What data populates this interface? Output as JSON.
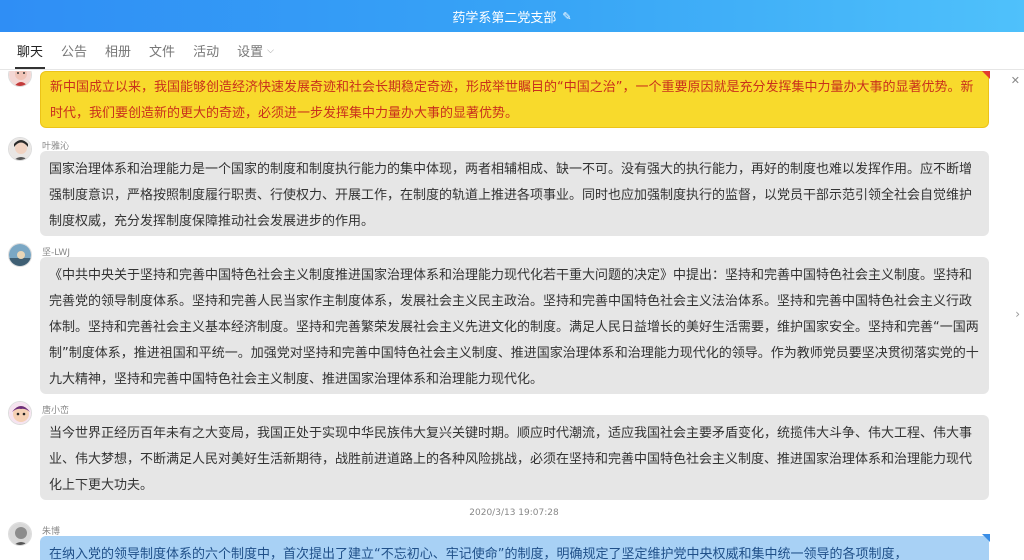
{
  "window": {
    "title": "药学系第二党支部",
    "edit_icon": "pencil-icon"
  },
  "tabs": [
    {
      "label": "聊天",
      "active": true
    },
    {
      "label": "公告",
      "active": false
    },
    {
      "label": "相册",
      "active": false
    },
    {
      "label": "文件",
      "active": false
    },
    {
      "label": "活动",
      "active": false
    },
    {
      "label": "设置",
      "active": false
    }
  ],
  "tab_caret": "⌵",
  "messages": [
    {
      "sender": "",
      "text": "新中国成立以来，我国能够创造经济快速发展奇迹和社会长期稳定奇迹，形成举世瞩目的“中国之治”，一个重要原因就是充分发挥集中力量办大事的显著优势。新时代，我们要创造新的更大的奇迹，必须进一步发挥集中力量办大事的显著优势。",
      "style": "yellow"
    },
    {
      "sender": "叶雅沁",
      "text": "国家治理体系和治理能力是一个国家的制度和制度执行能力的集中体现，两者相辅相成、缺一不可。没有强大的执行能力，再好的制度也难以发挥作用。应不断增强制度意识，严格按照制度履行职责、行使权力、开展工作，在制度的轨道上推进各项事业。同时也应加强制度执行的监督，以党员干部示范引领全社会自觉维护制度权威，充分发挥制度保障推动社会发展进步的作用。",
      "style": "grey"
    },
    {
      "sender": "坚-LWJ",
      "text": "《中共中央关于坚持和完善中国特色社会主义制度推进国家治理体系和治理能力现代化若干重大问题的决定》中提出：坚持和完善中国特色社会主义制度。坚持和完善党的领导制度体系。坚持和完善人民当家作主制度体系，发展社会主义民主政治。坚持和完善中国特色社会主义法治体系。坚持和完善中国特色社会主义行政体制。坚持和完善社会主义基本经济制度。坚持和完善繁荣发展社会主义先进文化的制度。满足人民日益增长的美好生活需要，维护国家安全。坚持和完善“一国两制”制度体系，推进祖国和平统一。加强党对坚持和完善中国特色社会主义制度、推进国家治理体系和治理能力现代化的领导。作为教师党员要坚决贯彻落实党的十九大精神，坚持和完善中国特色社会主义制度、推进国家治理体系和治理能力现代化。",
      "style": "grey"
    },
    {
      "sender": "唐小峦",
      "text": "当今世界正经历百年未有之大变局，我国正处于实现中华民族伟大复兴关键时期。顺应时代潮流，适应我国社会主要矛盾变化，统揽伟大斗争、伟大工程、伟大事业、伟大梦想，不断满足人民对美好生活新期待，战胜前进道路上的各种风险挑战，必须在坚持和完善中国特色社会主义制度、推进国家治理体系和治理能力现代化上下更大功夫。",
      "style": "grey"
    },
    {
      "sender": "朱博",
      "text": "在纳入党的领导制度体系的六个制度中，首次提出了建立“不忘初心、牢记使命”的制度，明确规定了坚定维护党中央权威和集中统一领导的各项制度，",
      "style": "blue"
    }
  ],
  "timestamp": "2020/3/13 19:07:28",
  "right_arrow": "›",
  "close_icon": "✕",
  "colors": {
    "title_start": "#2f8ef5",
    "title_end": "#4fc1fb",
    "highlight": "#f8da2c",
    "highlight_text": "#c9301c",
    "bubble_grey": "#e6e6e6",
    "bubble_blue": "#a8d1f5"
  }
}
